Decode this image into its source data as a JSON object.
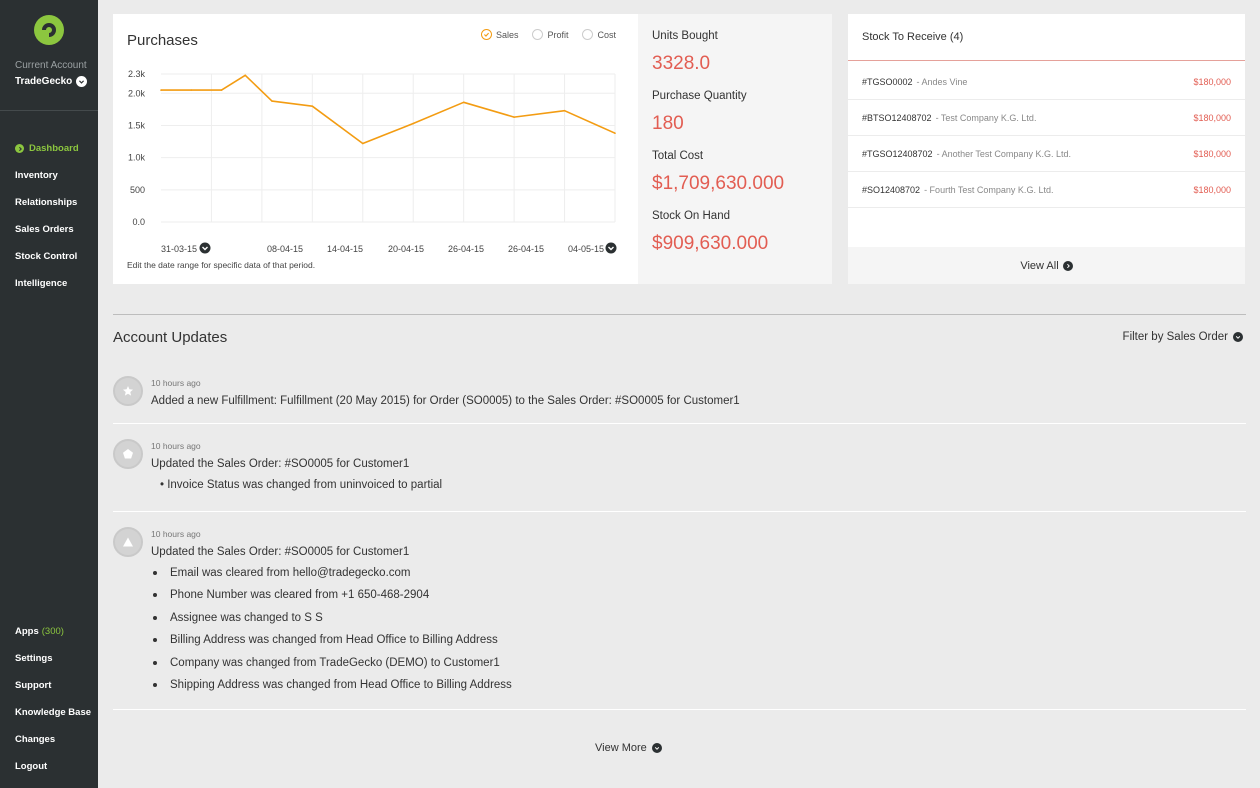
{
  "sidebar": {
    "account_label": "Current Account",
    "account_name": "TradeGecko",
    "nav": [
      {
        "label": "Dashboard",
        "active": true
      },
      {
        "label": "Inventory"
      },
      {
        "label": "Relationships"
      },
      {
        "label": "Sales Orders"
      },
      {
        "label": "Stock Control"
      },
      {
        "label": "Intelligence"
      }
    ],
    "bottom_nav": [
      {
        "label": "Apps",
        "count": "(300)"
      },
      {
        "label": "Settings"
      },
      {
        "label": "Support"
      },
      {
        "label": "Knowledge Base"
      },
      {
        "label": "Changes"
      },
      {
        "label": "Logout"
      }
    ]
  },
  "purchases": {
    "title": "Purchases",
    "legend": [
      {
        "label": "Sales",
        "checked": true
      },
      {
        "label": "Profit",
        "checked": false
      },
      {
        "label": "Cost",
        "checked": false
      }
    ],
    "note": "Edit the date range for specific data of that period."
  },
  "chart_data": {
    "type": "line",
    "series": [
      {
        "name": "Sales",
        "color": "#f39c12",
        "values": [
          2050,
          2050,
          2050,
          2280,
          1880,
          1800,
          1220,
          1530,
          1860,
          1630,
          1730,
          1380
        ]
      }
    ],
    "x_positions": [
      0,
      0.6,
      1.2,
      1.67,
      2.2,
      3.0,
      4.0,
      5.0,
      6.0,
      7.0,
      8.0,
      9.0
    ],
    "x_tick_labels": [
      "31-03-15",
      "08-04-15",
      "14-04-15",
      "20-04-15",
      "26-04-15",
      "26-04-15",
      "04-05-15"
    ],
    "y_ticks": [
      {
        "label": "2.3k",
        "value": 2300
      },
      {
        "label": "2.0k",
        "value": 2000
      },
      {
        "label": "1.5k",
        "value": 1500
      },
      {
        "label": "1.0k",
        "value": 1000
      },
      {
        "label": "500",
        "value": 500
      },
      {
        "label": "0.0",
        "value": 0
      }
    ],
    "ylim": [
      0,
      2300
    ],
    "grid": true
  },
  "stats": [
    {
      "label": "Units Bought",
      "value": "3328.0"
    },
    {
      "label": "Purchase Quantity",
      "value": "180"
    },
    {
      "label": "Total Cost",
      "value": "$1,709,630.000"
    },
    {
      "label": "Stock On Hand",
      "value": "$909,630.000"
    }
  ],
  "stock": {
    "title": "Stock To Receive (4)",
    "rows": [
      {
        "code": "#TGSO0002",
        "name": "-  Andes Vine",
        "amount": "$180,000"
      },
      {
        "code": "#BTSO12408702",
        "name": "-  Test Company K.G. Ltd.",
        "amount": "$180,000"
      },
      {
        "code": "#TGSO12408702",
        "name": "-  Another Test Company K.G. Ltd.",
        "amount": "$180,000"
      },
      {
        "code": "#SO12408702",
        "name": "-  Fourth Test Company K.G. Ltd.",
        "amount": "$180,000"
      }
    ],
    "view_all": "View All"
  },
  "updates": {
    "title": "Account Updates",
    "filter": "Filter by Sales Order",
    "items": [
      {
        "icon": "star-icon",
        "time": "10 hours ago",
        "text": "Added a new Fulfillment: Fulfillment (20 May 2015) for Order (SO0005) to the Sales Order: #SO0005 for Customer1"
      },
      {
        "icon": "pentagon-icon",
        "time": "10 hours ago",
        "text": "Updated the Sales Order: #SO0005 for Customer1",
        "details": [
          "• Invoice Status was changed from uninvoiced to partial"
        ]
      },
      {
        "icon": "triangle-icon",
        "time": "10 hours ago",
        "text": "Updated the Sales Order: #SO0005 for Customer1",
        "bullets": [
          "Email was cleared from hello@tradegecko.com",
          "Phone Number was cleared from +1 650-468-2904",
          "Assignee was changed to S S",
          "Billing Address was changed from Head Office to Billing Address",
          "Company was changed from TradeGecko (DEMO) to Customer1",
          "Shipping Address was changed from Head Office to Billing Address"
        ]
      }
    ],
    "view_more": "View More"
  },
  "colors": {
    "sidebar_bg": "#2b3032",
    "accent_green": "#8cc63f",
    "chart_line": "#f39c12",
    "value_red": "#e25d52"
  }
}
